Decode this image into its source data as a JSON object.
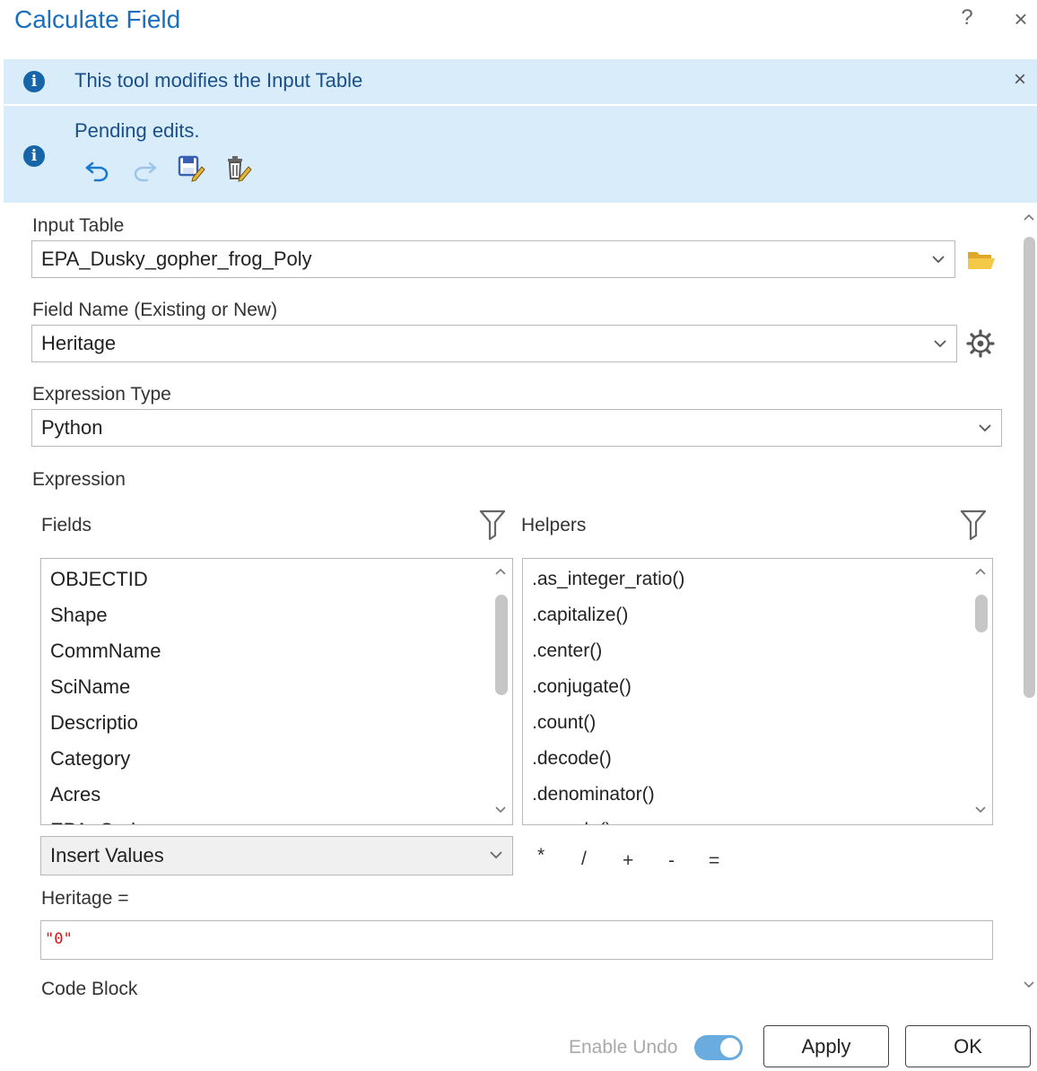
{
  "window": {
    "title": "Calculate Field",
    "help": "?",
    "close": "×"
  },
  "banners": {
    "info": {
      "text": "This tool modifies the Input Table",
      "close": "×"
    },
    "pending": {
      "text": "Pending edits."
    }
  },
  "form": {
    "input_table": {
      "label": "Input Table",
      "value": "EPA_Dusky_gopher_frog_Poly"
    },
    "field_name": {
      "label": "Field Name (Existing or New)",
      "value": "Heritage"
    },
    "expression_type": {
      "label": "Expression Type",
      "value": "Python"
    },
    "expression_label": "Expression",
    "fields": {
      "label": "Fields",
      "items": [
        "OBJECTID",
        "Shape",
        "CommName",
        "SciName",
        "Descriptio",
        "Category",
        "Acres",
        "EPA_Code"
      ]
    },
    "helpers": {
      "label": "Helpers",
      "items": [
        ".as_integer_ratio()",
        ".capitalize()",
        ".center()",
        ".conjugate()",
        ".count()",
        ".decode()",
        ".denominator()",
        ".encode()"
      ]
    },
    "insert_values": "Insert Values",
    "operators": [
      "*",
      "/",
      "+",
      "-",
      "="
    ],
    "assign_label": "Heritage =",
    "expression_value": "\"0\"",
    "code_block_label": "Code Block"
  },
  "footer": {
    "enable_undo": "Enable Undo",
    "apply": "Apply",
    "ok": "OK"
  },
  "colors": {
    "title": "#1a6fbf",
    "banner": "#d8ecfa",
    "info_icon": "#1565a8",
    "toggle": "#6aace0",
    "expression_text": "#d01818"
  }
}
